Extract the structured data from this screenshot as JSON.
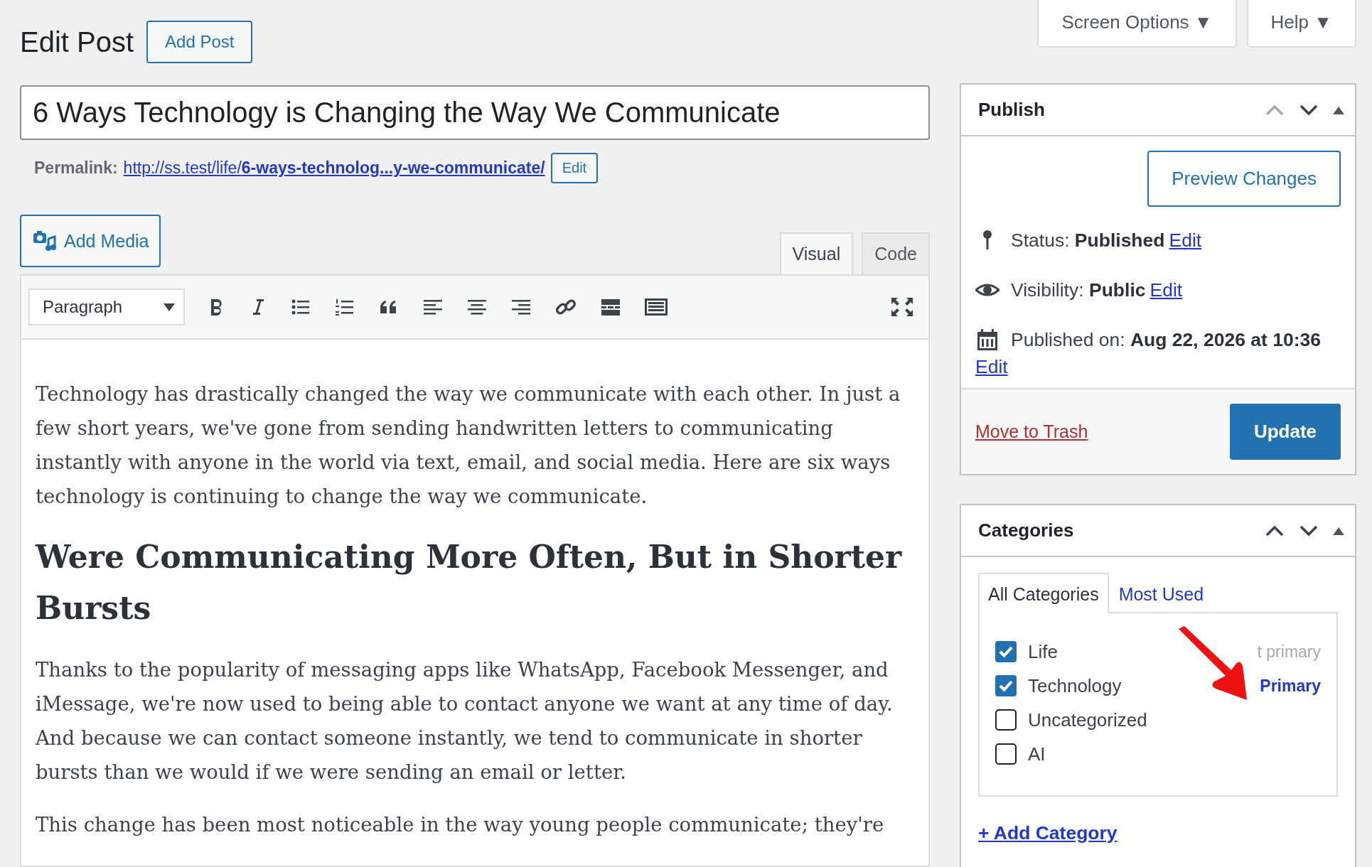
{
  "header": {
    "title": "Edit Post",
    "add_button": "Add Post",
    "screen_options": "Screen Options ▼",
    "help": "Help ▼"
  },
  "post": {
    "title": "6 Ways Technology is Changing the Way We Communicate",
    "permalink_label": "Permalink:",
    "permalink_base": "http://ss.test/life/",
    "permalink_slug": "6-ways-technolog...y-we-communicate/",
    "permalink_edit": "Edit"
  },
  "editor": {
    "add_media": "Add Media",
    "tabs": [
      {
        "label": "Visual",
        "selected": true
      },
      {
        "label": "Code",
        "selected": false
      }
    ],
    "format": "Paragraph",
    "toolbar": [
      {
        "kind": "bold"
      },
      {
        "kind": "italic"
      },
      {
        "kind": "bullet-list"
      },
      {
        "kind": "numbered-list"
      },
      {
        "kind": "quote"
      },
      {
        "kind": "align-left"
      },
      {
        "kind": "align-center"
      },
      {
        "kind": "align-right"
      },
      {
        "kind": "link"
      },
      {
        "kind": "read-more"
      },
      {
        "kind": "toolbar-toggle"
      }
    ],
    "content": [
      {
        "kind": "p",
        "text": "Technology has drastically changed the way we communicate with each other. In just a few short years, we've gone from sending handwritten letters to communicating instantly with anyone in the world via text, email, and social media. Here are six ways technology is continuing to change the way we communicate."
      },
      {
        "kind": "h2",
        "text": "Were Communicating More Often, But in Shorter Bursts"
      },
      {
        "kind": "p",
        "text": "Thanks to the popularity of messaging apps like WhatsApp, Facebook Messenger, and iMessage, we're now used to being able to contact anyone we want at any time of day. And because we can contact someone instantly, we tend to communicate in shorter bursts than we would if we were sending an email or letter."
      },
      {
        "kind": "p",
        "text": "This change has been most noticeable in the way young people communicate; they're"
      }
    ]
  },
  "publish": {
    "title": "Publish",
    "preview": "Preview Changes",
    "rows": [
      {
        "kind": "status",
        "label": "Status:",
        "value": "Published",
        "edit": "Edit"
      },
      {
        "kind": "visibility",
        "label": "Visibility:",
        "value": "Public",
        "edit": "Edit"
      },
      {
        "kind": "date",
        "label": "Published on:",
        "value": "Aug 22, 2026 at 10:36",
        "edit": "Edit"
      }
    ],
    "trash": "Move to Trash",
    "update": "Update"
  },
  "categories": {
    "title": "Categories",
    "tabs": [
      {
        "label": "All Categories",
        "selected": true
      },
      {
        "label": "Most Used",
        "selected": false
      }
    ],
    "items": [
      {
        "label": "Life",
        "checked": true,
        "action": "t primary",
        "primary": false
      },
      {
        "label": "Technology",
        "checked": true,
        "action": "Primary",
        "primary": true
      },
      {
        "label": "Uncategorized",
        "checked": false
      },
      {
        "label": "AI",
        "checked": false
      }
    ],
    "add": "+ Add Category"
  }
}
